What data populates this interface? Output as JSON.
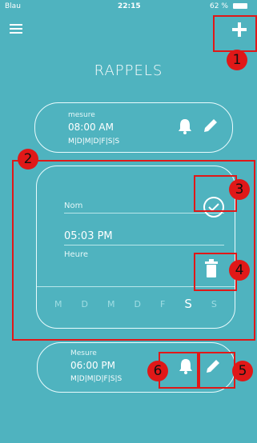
{
  "status_bar": {
    "carrier": "Blau",
    "time": "22:15",
    "battery": "62 %"
  },
  "header": {
    "title": "RAPPELS"
  },
  "reminders": [
    {
      "label": "mesure",
      "time": "08:00 AM",
      "days": "M|D|M|D|F|S|S"
    },
    {
      "name_label": "Nom",
      "time": "05:03 PM",
      "time_label": "Heure",
      "days": [
        "M",
        "D",
        "M",
        "D",
        "F",
        "S",
        "S"
      ],
      "active_day_index": 5
    },
    {
      "label": "Mesure",
      "time": "06:00 PM",
      "days": "M|D|M|D|F|S|S"
    }
  ],
  "annotations": [
    "1",
    "2",
    "3",
    "4",
    "5",
    "6"
  ],
  "colors": {
    "background": "#4fb3bf",
    "annotation": "#e01818"
  }
}
